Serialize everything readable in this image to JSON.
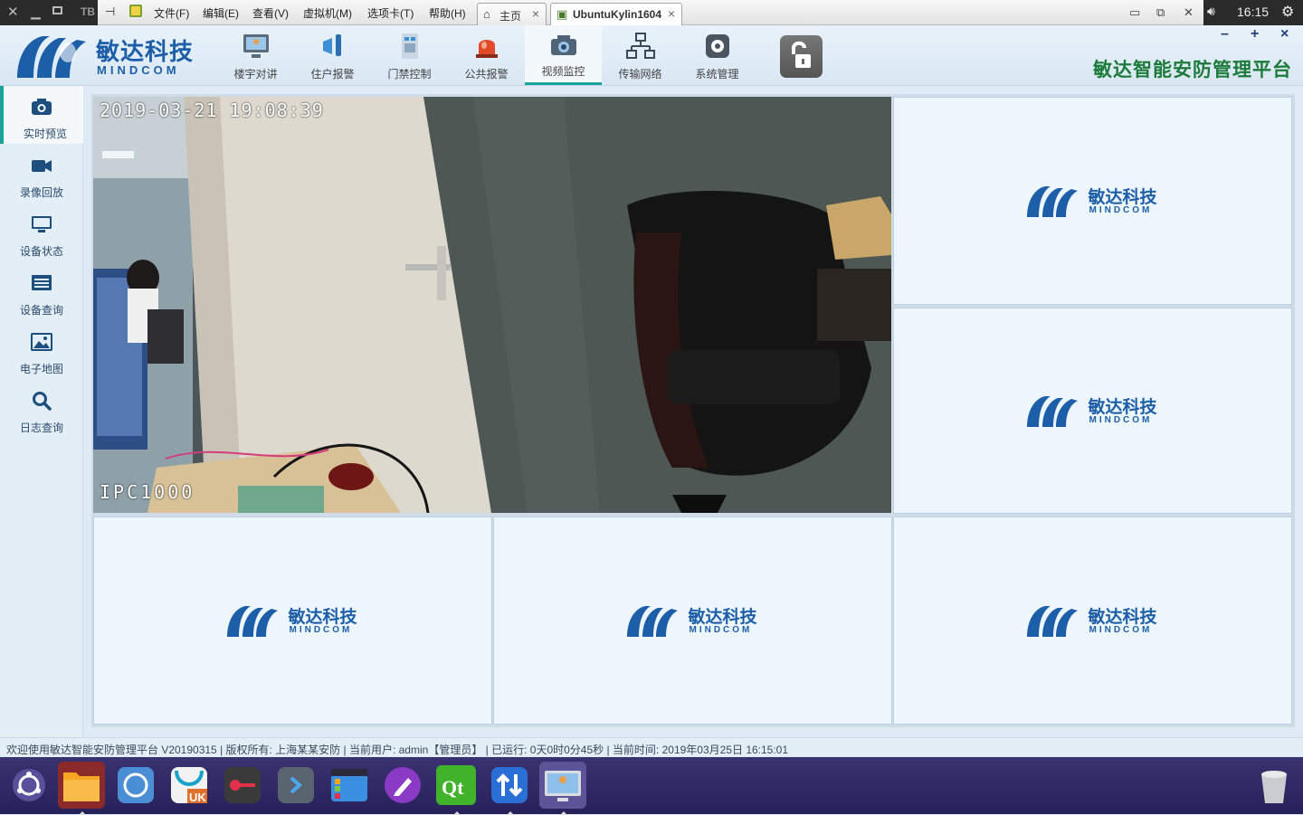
{
  "vm": {
    "tb_label": "TB",
    "menus": [
      "文件(F)",
      "编辑(E)",
      "查看(V)",
      "虚拟机(M)",
      "选项卡(T)",
      "帮助(H)"
    ],
    "tabs": [
      {
        "label": "主页",
        "icon": "home-icon",
        "active": false
      },
      {
        "label": "UbuntuKylin1604",
        "icon": "vm-icon",
        "active": true
      }
    ],
    "clock": "16:15"
  },
  "app": {
    "logo_cn": "敏达科技",
    "logo_en": "MINDCOM",
    "title": "敏达智能安防管理平台",
    "nav": [
      {
        "label": "楼宇对讲",
        "icon": "intercom-icon",
        "active": false
      },
      {
        "label": "住户报警",
        "icon": "resident-alarm-icon",
        "active": false
      },
      {
        "label": "门禁控制",
        "icon": "access-control-icon",
        "active": false
      },
      {
        "label": "公共报警",
        "icon": "public-alarm-icon",
        "active": false
      },
      {
        "label": "视频监控",
        "icon": "video-monitor-icon",
        "active": true
      },
      {
        "label": "传输网络",
        "icon": "network-icon",
        "active": false
      },
      {
        "label": "系统管理",
        "icon": "system-settings-icon",
        "active": false
      }
    ],
    "window_controls": [
      "–",
      "+",
      "×"
    ]
  },
  "sidebar": [
    {
      "label": "实时预览",
      "icon": "camera-icon",
      "active": true
    },
    {
      "label": "录像回放",
      "icon": "video-camera-icon",
      "active": false
    },
    {
      "label": "设备状态",
      "icon": "monitor-icon",
      "active": false
    },
    {
      "label": "设备查询",
      "icon": "list-icon",
      "active": false
    },
    {
      "label": "电子地图",
      "icon": "map-image-icon",
      "active": false
    },
    {
      "label": "日志查询",
      "icon": "search-icon",
      "active": false
    }
  ],
  "video": {
    "osd_time": "2019-03-21  19:08:39",
    "osd_name": "IPC1000",
    "placeholder_logo_cn": "敏达科技",
    "placeholder_logo_en": "MINDCOM"
  },
  "status": {
    "text": "欢迎使用敏达智能安防管理平台 V20190315 | 版权所有: 上海某某安防 | 当前用户: admin【管理员】 | 已运行: 0天0时0分45秒 | 当前时间: 2019年03月25日 16:15:01"
  },
  "dock": [
    {
      "name": "ubuntu-kylin-start",
      "icon": "kylin-logo-icon",
      "running": false
    },
    {
      "name": "files",
      "icon": "folder-icon",
      "running": true
    },
    {
      "name": "browser",
      "icon": "browser-icon",
      "running": false
    },
    {
      "name": "software-center",
      "icon": "uk-store-icon",
      "running": false
    },
    {
      "name": "recorder",
      "icon": "record-icon",
      "running": false
    },
    {
      "name": "terminal",
      "icon": "terminal-icon",
      "running": false
    },
    {
      "name": "app-store",
      "icon": "app-store-icon",
      "running": false
    },
    {
      "name": "text-editor",
      "icon": "pen-icon",
      "running": false
    },
    {
      "name": "qt-creator",
      "icon": "qt-icon",
      "running": true
    },
    {
      "name": "transfer",
      "icon": "transfer-icon",
      "running": true
    },
    {
      "name": "security-platform",
      "icon": "platform-icon",
      "running": true
    },
    {
      "name": "trash",
      "icon": "trash-icon",
      "running": false
    }
  ]
}
